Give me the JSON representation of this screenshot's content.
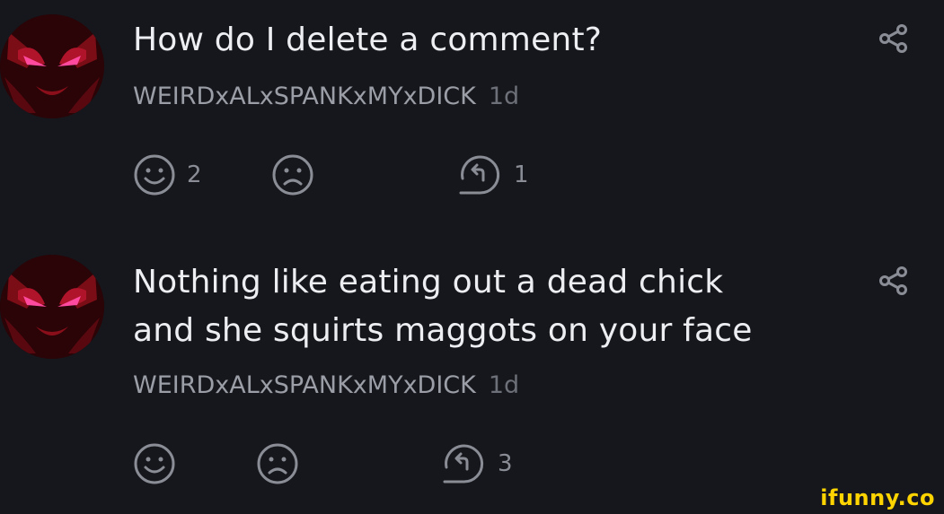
{
  "comments": [
    {
      "text_lines": [
        "How do I delete a comment?"
      ],
      "username": "WEIRDxALxSPANKxMYxDICK",
      "time": "1d",
      "smile_count": "2",
      "frown_count": "",
      "reply_count": "1"
    },
    {
      "text_lines": [
        "Nothing like eating out a dead chick",
        "and she squirts maggots on your face"
      ],
      "username": "WEIRDxALxSPANKxMYxDICK",
      "time": "1d",
      "smile_count": "",
      "frown_count": "",
      "reply_count": "3"
    }
  ],
  "watermark": "ifunny.co",
  "colors": {
    "background": "#16171c",
    "text": "#eceef2",
    "username": "#9b9ea6",
    "icon": "#8a8d95",
    "watermark": "#ffd400"
  }
}
